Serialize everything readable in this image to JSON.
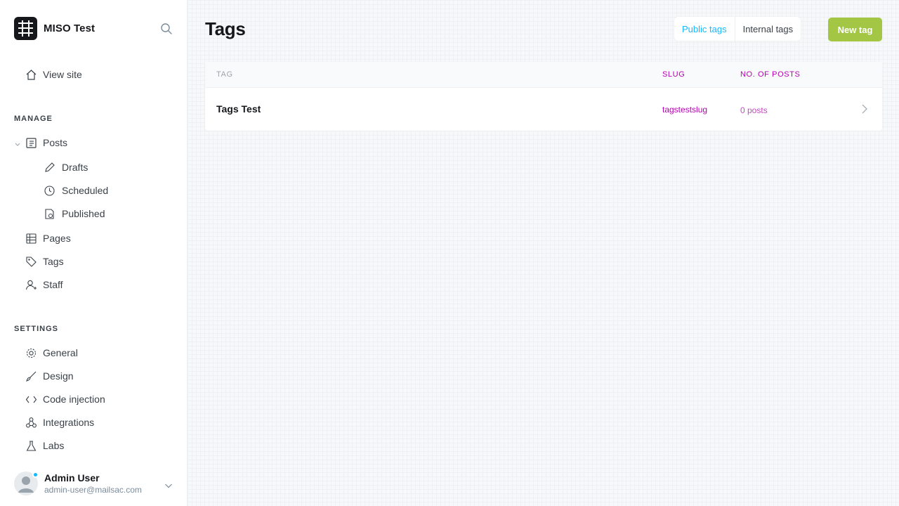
{
  "app": {
    "site_name": "MISO Test"
  },
  "sidebar": {
    "view_site": "View site",
    "manage_label": "MANAGE",
    "posts": "Posts",
    "drafts": "Drafts",
    "scheduled": "Scheduled",
    "published": "Published",
    "pages": "Pages",
    "tags": "Tags",
    "staff": "Staff",
    "settings_label": "SETTINGS",
    "general": "General",
    "design": "Design",
    "code_injection": "Code injection",
    "integrations": "Integrations",
    "labs": "Labs"
  },
  "user": {
    "name": "Admin User",
    "email": "admin-user@mailsac.com"
  },
  "header": {
    "title": "Tags",
    "public_tags": "Public tags",
    "internal_tags": "Internal tags",
    "new_tag": "New tag"
  },
  "table": {
    "col_tag": "TAG",
    "col_slug": "SLUG",
    "col_posts": "NO. OF POSTS",
    "rows": [
      {
        "name": "Tags Test",
        "slug": "tagstestslug",
        "posts": "0 posts"
      }
    ]
  },
  "colors": {
    "accent": "#14b8ff",
    "primary_button": "#a3c644",
    "slug_color": "#b600b5"
  },
  "icons": [
    "search-icon",
    "home-icon",
    "posts-icon",
    "pencil-icon",
    "clock-icon",
    "published-icon",
    "pages-icon",
    "tag-icon",
    "staff-icon",
    "gear-icon",
    "brush-icon",
    "code-icon",
    "integrations-icon",
    "labs-icon",
    "chevron-down-icon",
    "chevron-right-icon"
  ]
}
